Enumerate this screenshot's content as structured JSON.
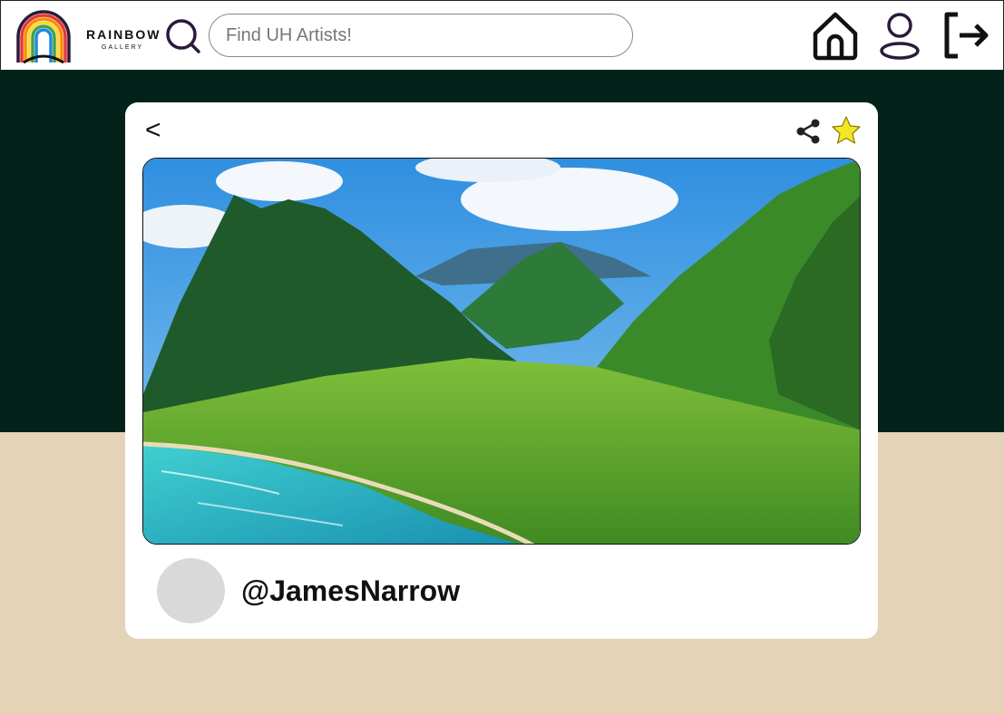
{
  "header": {
    "logo_text": "RAINBOW",
    "logo_sub": "GALLERY",
    "search": {
      "placeholder": "Find UH Artists!"
    },
    "icons": [
      "search-icon",
      "home-icon",
      "user-icon",
      "logout-icon"
    ]
  },
  "card": {
    "back_label": "<",
    "icons": [
      "share-icon",
      "star-icon"
    ],
    "artwork_subject": "mountain valley landscape",
    "username": "@JamesNarrow"
  },
  "colors": {
    "dark_band": "#03231a",
    "page_bg": "#e5d3b8",
    "search_icon": "#2c1a3a",
    "star": "#f5e625"
  }
}
